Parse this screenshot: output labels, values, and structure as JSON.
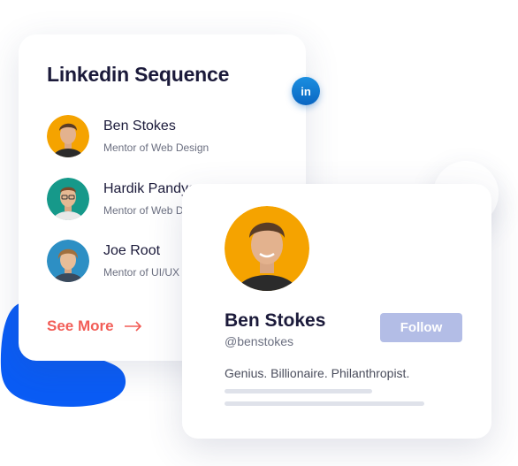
{
  "linkedin_card": {
    "title": "Linkedin Sequence",
    "people": [
      {
        "name": "Ben Stokes",
        "role": "Mentor of Web Design",
        "avatar_bg": "#f5a300"
      },
      {
        "name": "Hardik Pandya",
        "role": "Mentor of Web Design",
        "avatar_bg": "#16998a"
      },
      {
        "name": "Joe Root",
        "role": "Mentor of UI/UX Design",
        "avatar_bg": "#2d8fc4"
      }
    ],
    "see_more_label": "See More"
  },
  "profile_card": {
    "name": "Ben Stokes",
    "handle": "@benstokes",
    "follow_label": "Follow",
    "bio": "Genius. Billionaire. Philanthropist.",
    "avatar_bg": "#f5a300"
  },
  "badges": {
    "linkedin_text": "in",
    "linkedin_color": "#0a66c2",
    "twitter_color": "#1d9bf0"
  },
  "colors": {
    "accent": "#f25d57",
    "blob": "#0a5cf5",
    "follow_button": "#b3bde6"
  },
  "icons": [
    "linkedin-icon",
    "twitter-icon",
    "arrow-right-icon"
  ]
}
